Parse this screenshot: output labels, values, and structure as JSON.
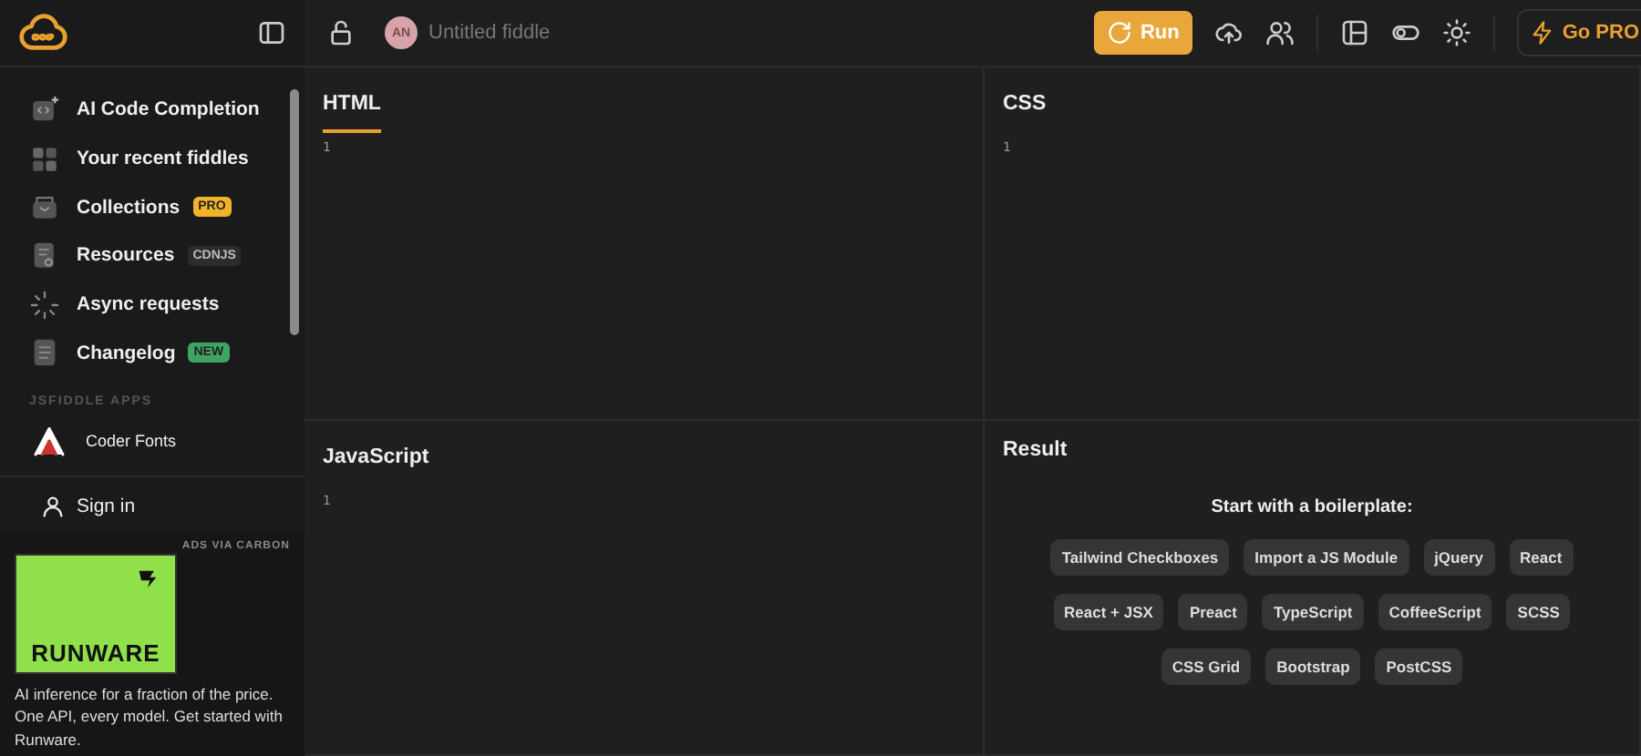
{
  "header": {
    "avatar": "AN",
    "title": "Untitled fiddle",
    "run_button": "Run",
    "pro_button": "Go PRO"
  },
  "sidebar": {
    "items": [
      {
        "label": "AI Code Completion",
        "kind": "code"
      },
      {
        "label": "Your recent fiddles",
        "kind": "grid"
      },
      {
        "label": "Collections",
        "kind": "box",
        "badge": {
          "text": "PRO",
          "color": "#f0b429"
        }
      },
      {
        "label": "Resources",
        "kind": "doc",
        "badge": {
          "text": "CDNJS",
          "color": "#2c2c2c"
        }
      },
      {
        "label": "Async requests",
        "kind": "spinner"
      },
      {
        "label": "Changelog",
        "kind": "list",
        "badge": {
          "text": "NEW",
          "color": "#3fa463"
        }
      }
    ],
    "apps_heading": "JSFIDDLE APPS",
    "apps": [
      {
        "label": "Coder Fonts"
      }
    ],
    "sign_in": "Sign in",
    "ad": {
      "label": "ADS VIA CARBON",
      "brand": "RUNWARE",
      "text": "AI inference for a fraction of the price. One API, every model. Get started with Runware."
    }
  },
  "panels": [
    {
      "title": "HTML",
      "selected": true,
      "lines": [
        "1"
      ]
    },
    {
      "title": "CSS",
      "selected": false,
      "lines": [
        "1"
      ]
    },
    {
      "title": "JavaScript",
      "selected": false,
      "lines": [
        "1"
      ]
    }
  ],
  "result": {
    "title": "Result",
    "heading": "Start with a boilerplate:",
    "boilerplates": [
      "Tailwind Checkboxes",
      "Import a JS Module",
      "jQuery",
      "React",
      "React + JSX",
      "Preact",
      "TypeScript",
      "CoffeeScript",
      "SCSS",
      "CSS Grid",
      "Bootstrap",
      "PostCSS"
    ]
  }
}
